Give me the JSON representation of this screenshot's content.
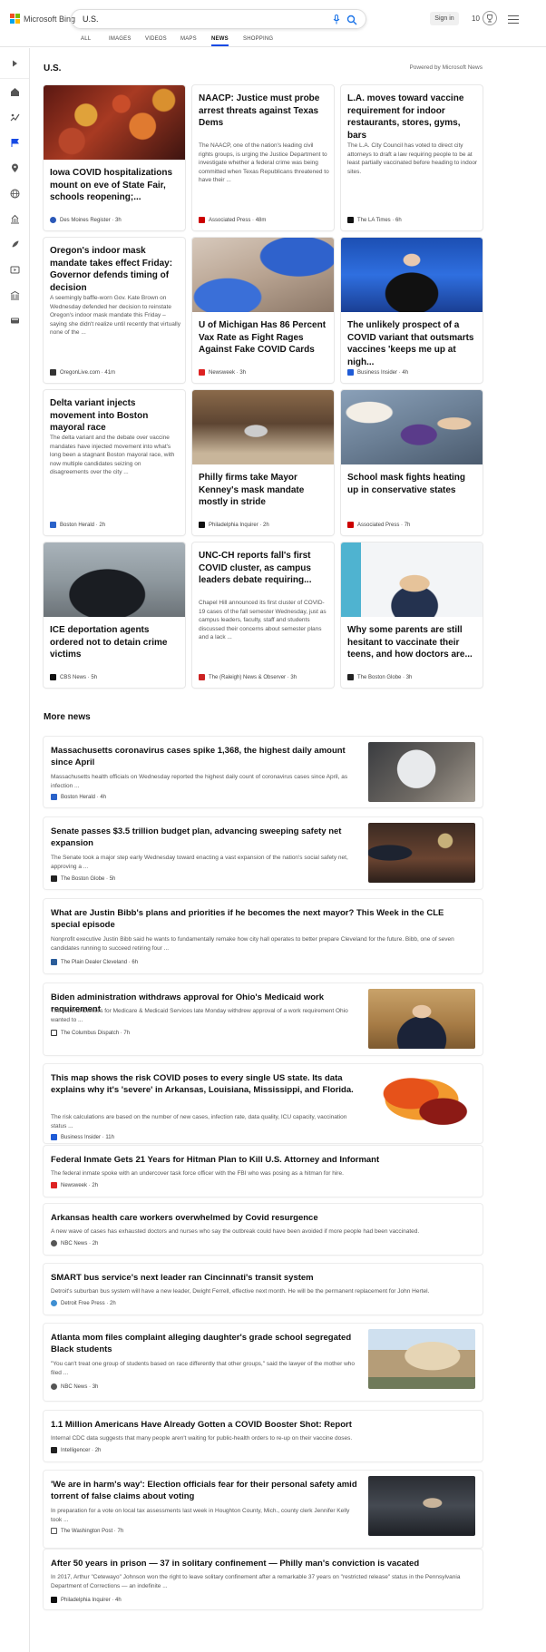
{
  "header": {
    "brand": "Microsoft Bing",
    "query": "U.S.",
    "signin": "Sign in",
    "points": "10",
    "tabs": [
      "ALL",
      "IMAGES",
      "VIDEOS",
      "MAPS",
      "NEWS",
      "SHOPPING"
    ],
    "active_tab": "NEWS"
  },
  "section": {
    "title": "U.S.",
    "powered": "Powered by Microsoft News"
  },
  "cards": [
    {
      "title": "Iowa COVID hospitalizations mount on eve of State Fair, schools reopening;...",
      "snippet": "",
      "source": "Des Moines Register",
      "time": "3h",
      "image": "covid-virus-image"
    },
    {
      "title": "NAACP: Justice must probe arrest threats against Texas Dems",
      "snippet": "The NAACP, one of the nation's leading civil rights groups, is urging the Justice Department to investigate whether a federal crime was being committed when Texas Republicans threatened to have their ...",
      "source": "Associated Press",
      "time": "48m",
      "image": ""
    },
    {
      "title": "L.A. moves toward vaccine requirement for indoor restaurants, stores, gyms, bars",
      "snippet": "The L.A. City Council has voted to direct city attorneys to draft a law requiring people to be at least partially vaccinated before heading to indoor sites.",
      "source": "The LA Times",
      "time": "6h",
      "image": ""
    },
    {
      "title": "Oregon's indoor mask mandate takes effect Friday: Governor defends timing of decision",
      "snippet": "A seemingly baffle-worn Gov. Kate Brown on Wednesday defended her decision to reinstate Oregon's indoor mask mandate this Friday – saying she didn't realize until recently that virtually none of the ...",
      "source": "OregonLive.com",
      "time": "41m",
      "image": ""
    },
    {
      "title": "U of Michigan Has 86 Percent Vax Rate as Fight Rages Against Fake COVID Cards",
      "snippet": "",
      "source": "Newsweek",
      "time": "3h",
      "image": "vaccine-injection-image"
    },
    {
      "title": "The unlikely prospect of a COVID variant that outsmarts vaccines 'keeps me up at nigh...",
      "snippet": "",
      "source": "Business Insider",
      "time": "4h",
      "image": "official-speaking-image"
    },
    {
      "title": "Delta variant injects movement into Boston mayoral race",
      "snippet": "The delta variant and the debate over vaccine mandates have injected movement into what's long been a stagnant Boston mayoral race, with now multiple candidates seizing on disagreements over the city ...",
      "source": "Boston Herald",
      "time": "2h",
      "image": ""
    },
    {
      "title": "Philly firms take Mayor Kenney's mask mandate mostly in stride",
      "snippet": "",
      "source": "Philadelphia Inquirer",
      "time": "2h",
      "image": "market-crowd-image"
    },
    {
      "title": "School mask fights heating up in conservative states",
      "snippet": "",
      "source": "Associated Press",
      "time": "7h",
      "image": "protest-signs-image"
    },
    {
      "title": "ICE deportation agents ordered not to detain crime victims",
      "snippet": "",
      "source": "CBS News",
      "time": "5h",
      "image": "police-ice-image"
    },
    {
      "title": "UNC-CH reports fall's first COVID cluster, as campus leaders debate requiring...",
      "snippet": "Chapel Hill announced its first cluster of COVID-19 cases of the fall semester Wednesday, just as campus leaders, faculty, staff and students discussed their concerns about semester plans and a lack ...",
      "source": "The (Raleigh) News & Observer",
      "time": "3h",
      "image": ""
    },
    {
      "title": "Why some parents are still hesitant to vaccinate their teens, and how doctors are...",
      "snippet": "",
      "source": "The Boston Globe",
      "time": "3h",
      "image": "woman-interview-image"
    }
  ],
  "more_news": {
    "title": "More news",
    "items": [
      {
        "title": "Massachusetts coronavirus cases spike 1,368, the highest daily amount since April",
        "snippet": "Massachusetts health officials on Wednesday reported the highest daily count of coronavirus cases since April, as infection ...",
        "source": "Boston Herald",
        "time": "4h",
        "thumb": "vaccination-sign-image"
      },
      {
        "title": "Senate passes $3.5 trillion budget plan, advancing sweeping safety net expansion",
        "snippet": "The Senate took a major step early Wednesday toward enacting a vast expansion of the nation's social safety net, approving a ...",
        "source": "The Boston Globe",
        "time": "5h",
        "thumb": "senate-image"
      },
      {
        "title": "What are Justin Bibb's plans and priorities if he becomes the next mayor? This Week in the CLE special episode",
        "snippet": "Nonprofit executive Justin Bibb said he wants to fundamentally remake how city hall operates to better prepare Cleveland for the future. Bibb, one of seven candidates running to succeed retiring four ...",
        "source": "The Plain Dealer Cleveland",
        "time": "6h",
        "thumb": ""
      },
      {
        "title": "Biden administration withdraws approval for Ohio's Medicaid work requirement",
        "snippet": "The federal Centers for Medicare & Medicaid Services late Monday withdrew approval of a work requirement Ohio wanted to ...",
        "source": "The Columbus Dispatch",
        "time": "7h",
        "thumb": "biden-image"
      },
      {
        "title": "This map shows the risk COVID poses to every single US state. Its data explains why it's 'severe' in Arkansas, Louisiana, Mississippi, and Florida.",
        "snippet": "The risk calculations are based on the number of new cases, infection rate, data quality, ICU capacity, vaccination status ...",
        "source": "Business Insider",
        "time": "11h",
        "thumb": "us-map-image"
      },
      {
        "title": "Federal Inmate Gets 21 Years for Hitman Plan to Kill U.S. Attorney and Informant",
        "snippet": "The federal inmate spoke with an undercover task force officer with the FBI who was posing as a hitman for hire.",
        "source": "Newsweek",
        "time": "2h",
        "thumb": ""
      },
      {
        "title": "Arkansas health care workers overwhelmed by Covid resurgence",
        "snippet": "A new wave of cases has exhausted doctors and nurses who say the outbreak could have been avoided if more people had been vaccinated.",
        "source": "NBC News",
        "time": "2h",
        "thumb": ""
      },
      {
        "title": "SMART bus service's next leader ran Cincinnati's transit system",
        "snippet": "Detroit's suburban bus system will have a new leader, Dwight Ferrell, effective next month. He will be the permanent replacement for John Hertel.",
        "source": "Detroit Free Press",
        "time": "2h",
        "thumb": ""
      },
      {
        "title": "Atlanta mom files complaint alleging daughter's grade school segregated Black students",
        "snippet": "\"You can't treat one group of students based on race differently that other groups,\" said the lawyer of the mother who filed ...",
        "source": "NBC News",
        "time": "3h",
        "thumb": "school-building-image"
      },
      {
        "title": "1.1 Million Americans Have Already Gotten a COVID Booster Shot: Report",
        "snippet": "Internal CDC data suggests that many people aren't waiting for public-health orders to re-up on their vaccine doses.",
        "source": "Intelligencer",
        "time": "2h",
        "thumb": ""
      },
      {
        "title": "'We are in harm's way': Election officials fear for their personal safety amid torrent of false claims about voting",
        "snippet": "In preparation for a vote on local tax assessments last week in Houghton County, Mich., county clerk Jennifer Kelly took ...",
        "source": "The Washington Post",
        "time": "7h",
        "thumb": "election-office-image"
      },
      {
        "title": "After 50 years in prison — 37 in solitary confinement — Philly man's conviction is vacated",
        "snippet": "In 2017, Arthur \"Cetewayo\" Johnson won the right to leave solitary confinement after a remarkable 37 years on \"restricted release\" status in the Pennsylvania Department of Corrections — an indefinite ...",
        "source": "Philadelphia Inquirer",
        "time": "4h",
        "thumb": ""
      }
    ]
  },
  "colors": {
    "accent": "#174ae4",
    "mic": "#1a73e8"
  }
}
